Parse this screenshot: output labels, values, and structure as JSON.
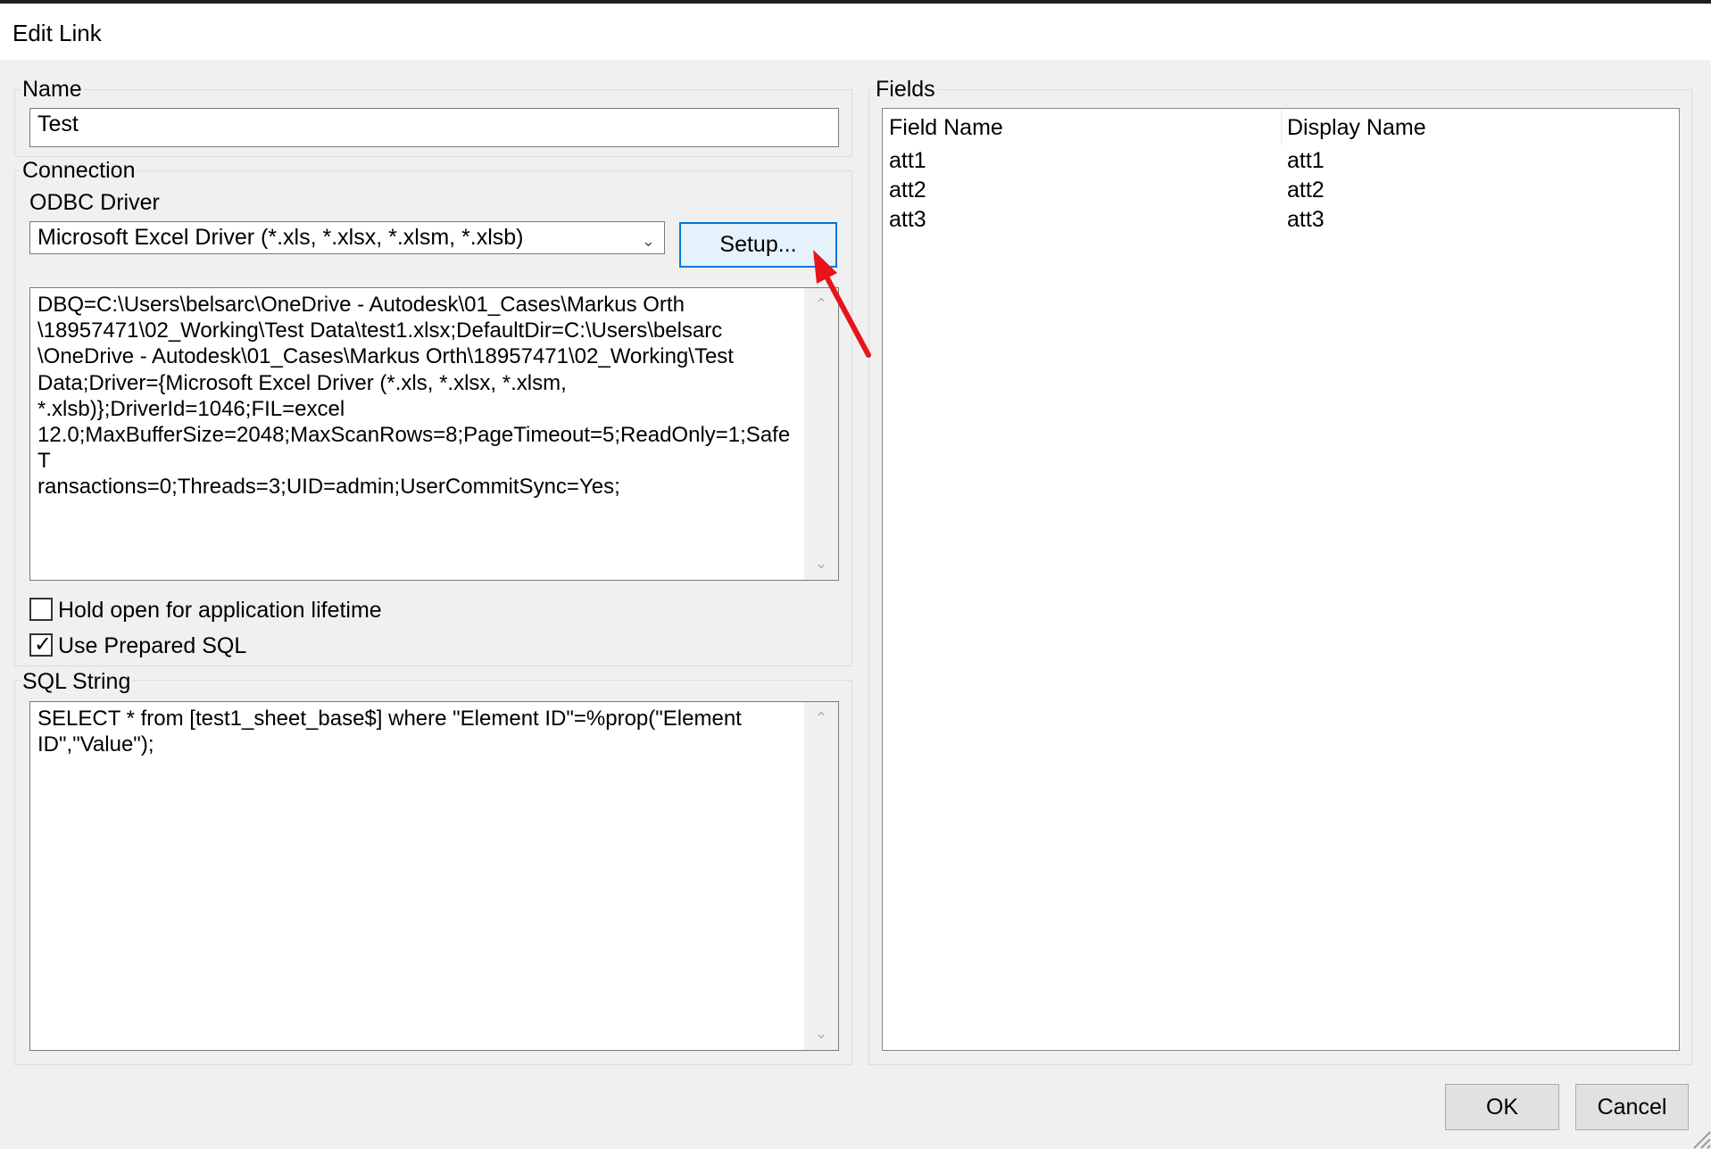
{
  "window": {
    "title": "Edit Link"
  },
  "name_group": {
    "legend": "Name",
    "value": "Test"
  },
  "connection_group": {
    "legend": "Connection",
    "odbc_label": "ODBC Driver",
    "driver_selected": "Microsoft Excel Driver (*.xls, *.xlsx, *.xlsm, *.xlsb)",
    "setup_label": "Setup...",
    "connection_string": "DBQ=C:\\Users\\belsarc\\OneDrive - Autodesk\\01_Cases\\Markus Orth\n\\18957471\\02_Working\\Test Data\\test1.xlsx;DefaultDir=C:\\Users\\belsarc\n\\OneDrive - Autodesk\\01_Cases\\Markus Orth\\18957471\\02_Working\\Test\nData;Driver={Microsoft Excel Driver (*.xls, *.xlsx, *.xlsm,\n*.xlsb)};DriverId=1046;FIL=excel\n12.0;MaxBufferSize=2048;MaxScanRows=8;PageTimeout=5;ReadOnly=1;SafeT\nransactions=0;Threads=3;UID=admin;UserCommitSync=Yes;",
    "hold_open_label": "Hold open for application lifetime",
    "hold_open_checked": false,
    "prepared_sql_label": "Use Prepared SQL",
    "prepared_sql_checked": true
  },
  "sql_group": {
    "legend": "SQL String",
    "value": "SELECT * from [test1_sheet_base$] where \"Element ID\"=%prop(\"Element\nID\",\"Value\");"
  },
  "fields_group": {
    "legend": "Fields",
    "columns": [
      "Field Name",
      "Display Name"
    ],
    "rows": [
      [
        "att1",
        "att1"
      ],
      [
        "att2",
        "att2"
      ],
      [
        "att3",
        "att3"
      ]
    ]
  },
  "footer": {
    "ok_label": "OK",
    "cancel_label": "Cancel"
  },
  "colors": {
    "annotation_arrow": "#e8141c",
    "focus_border": "#0078d7"
  }
}
